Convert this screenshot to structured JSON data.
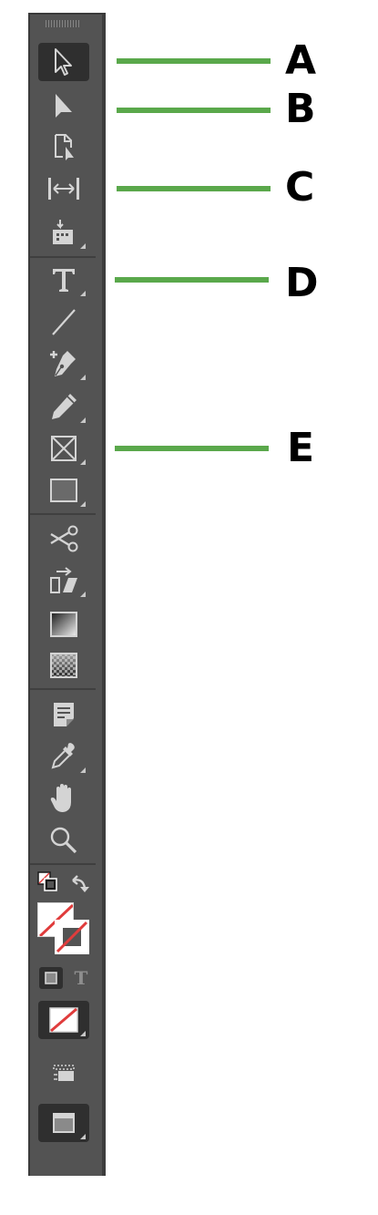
{
  "toolbar": {
    "tools": [
      {
        "name": "selection-tool",
        "icon": "hollow-arrow-icon",
        "active": true,
        "flyout": false
      },
      {
        "name": "direct-selection-tool",
        "icon": "solid-arrow-icon",
        "active": false,
        "flyout": false
      },
      {
        "name": "page-tool",
        "icon": "page-arrow-icon",
        "active": false,
        "flyout": false
      },
      {
        "name": "gap-tool",
        "icon": "gap-icon",
        "active": false,
        "flyout": false
      },
      {
        "name": "content-collector-tool",
        "icon": "content-collector-icon",
        "active": false,
        "flyout": true
      },
      {
        "name": "type-tool",
        "icon": "type-icon",
        "active": false,
        "flyout": true
      },
      {
        "name": "line-tool",
        "icon": "line-icon",
        "active": false,
        "flyout": false
      },
      {
        "name": "pen-tool",
        "icon": "pen-icon",
        "active": false,
        "flyout": true
      },
      {
        "name": "pencil-tool",
        "icon": "pencil-icon",
        "active": false,
        "flyout": true
      },
      {
        "name": "rectangle-frame-tool",
        "icon": "rectangle-frame-icon",
        "active": false,
        "flyout": true
      },
      {
        "name": "rectangle-tool",
        "icon": "rectangle-icon",
        "active": false,
        "flyout": true
      },
      {
        "name": "scissors-tool",
        "icon": "scissors-icon",
        "active": false,
        "flyout": false
      },
      {
        "name": "free-transform-tool",
        "icon": "free-transform-icon",
        "active": false,
        "flyout": true
      },
      {
        "name": "gradient-swatch-tool",
        "icon": "gradient-swatch-icon",
        "active": false,
        "flyout": false
      },
      {
        "name": "gradient-feather-tool",
        "icon": "gradient-feather-icon",
        "active": false,
        "flyout": false
      },
      {
        "name": "note-tool",
        "icon": "note-icon",
        "active": false,
        "flyout": false
      },
      {
        "name": "eyedropper-tool",
        "icon": "eyedropper-icon",
        "active": false,
        "flyout": true
      },
      {
        "name": "hand-tool",
        "icon": "hand-icon",
        "active": false,
        "flyout": false
      },
      {
        "name": "zoom-tool",
        "icon": "zoom-icon",
        "active": false,
        "flyout": false
      }
    ],
    "type_toggle_label": "T"
  },
  "callouts": [
    {
      "letter": "A"
    },
    {
      "letter": "B"
    },
    {
      "letter": "C"
    },
    {
      "letter": "D"
    },
    {
      "letter": "E"
    }
  ],
  "colors": {
    "panel": "#535353",
    "icon": "#d4d4d4",
    "active_bg": "#2f2f2f",
    "callout_line": "#5aa84b",
    "none_slash": "#e03c3c"
  }
}
